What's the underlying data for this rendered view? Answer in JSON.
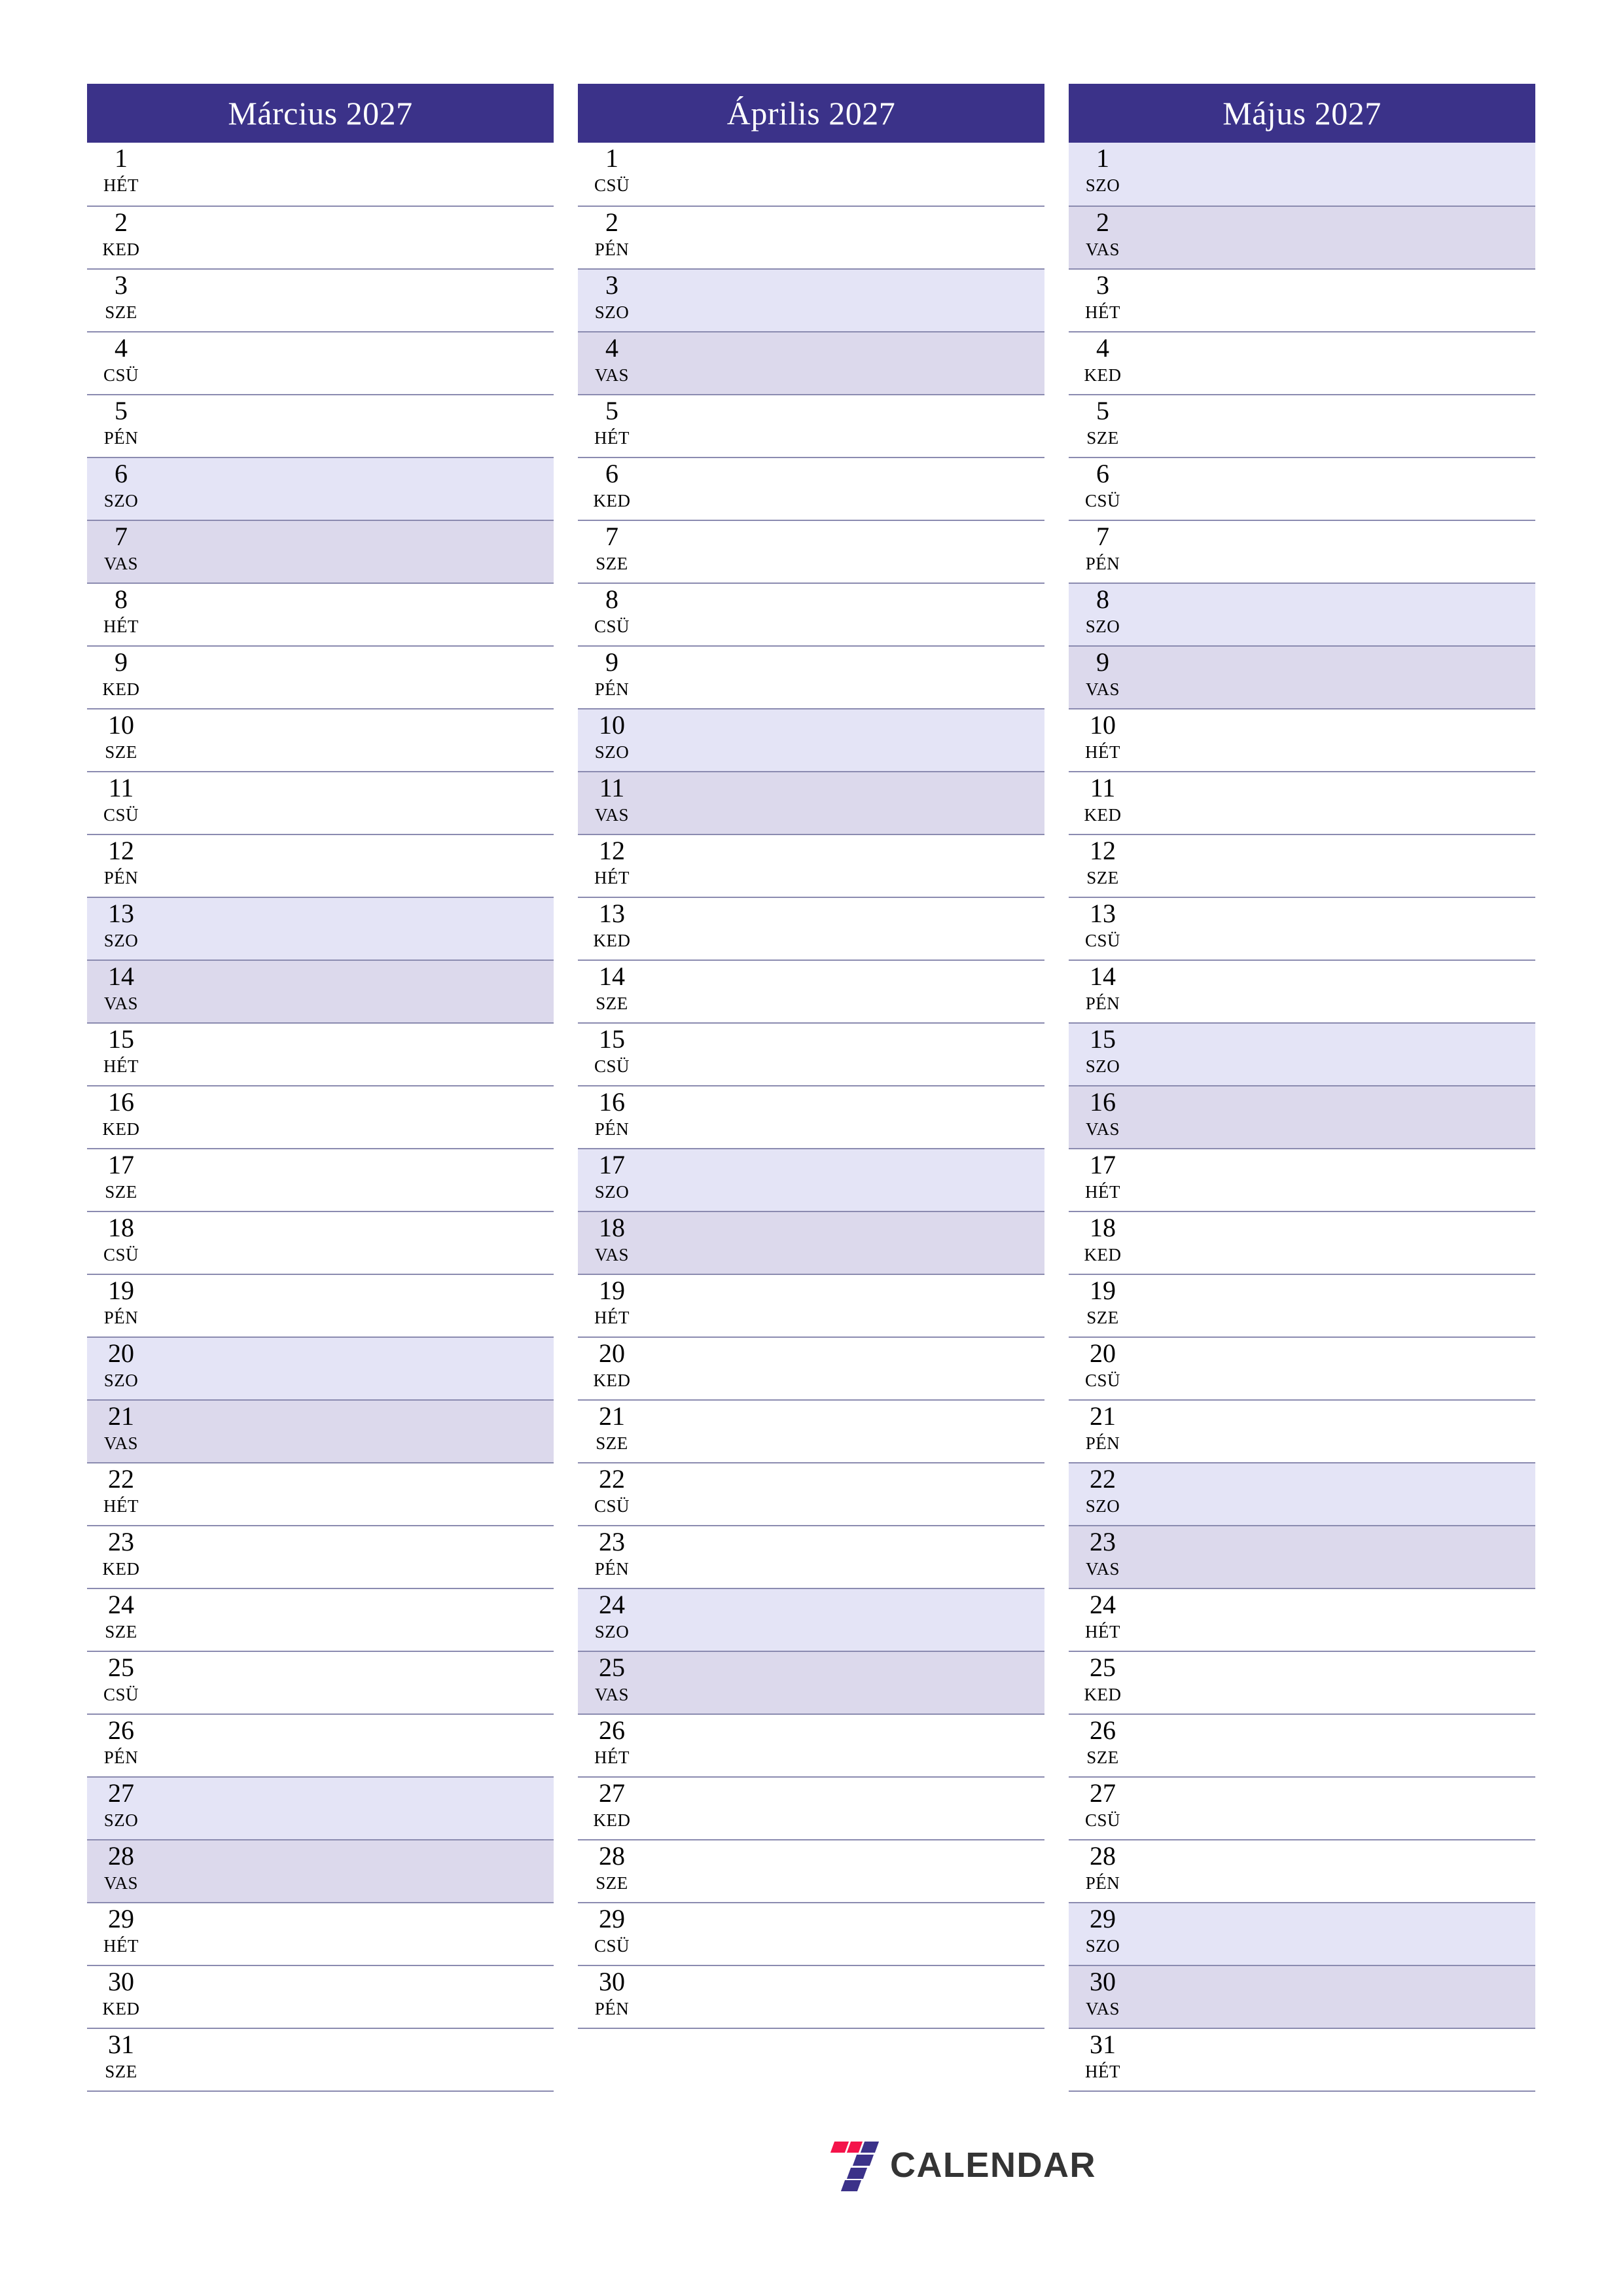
{
  "colors": {
    "header_bg": "#3b3289",
    "header_text": "#ffffff",
    "rule": "#8b8bb0",
    "saturday_bg": "#e4e4f6",
    "sunday_bg": "#dcd9ec",
    "page_bg": "#ffffff",
    "logo_red": "#f4134a",
    "logo_indigo": "#3b3289",
    "logo_text": "#343434"
  },
  "footer": {
    "logo_icon": "seven-blocks-icon",
    "brand": "CALENDAR"
  },
  "months": [
    {
      "title": "Március 2027",
      "days": [
        {
          "num": "1",
          "abbr": "HÉT",
          "type": "weekday"
        },
        {
          "num": "2",
          "abbr": "KED",
          "type": "weekday"
        },
        {
          "num": "3",
          "abbr": "SZE",
          "type": "weekday"
        },
        {
          "num": "4",
          "abbr": "CSÜ",
          "type": "weekday"
        },
        {
          "num": "5",
          "abbr": "PÉN",
          "type": "weekday"
        },
        {
          "num": "6",
          "abbr": "SZO",
          "type": "sat"
        },
        {
          "num": "7",
          "abbr": "VAS",
          "type": "sun"
        },
        {
          "num": "8",
          "abbr": "HÉT",
          "type": "weekday"
        },
        {
          "num": "9",
          "abbr": "KED",
          "type": "weekday"
        },
        {
          "num": "10",
          "abbr": "SZE",
          "type": "weekday"
        },
        {
          "num": "11",
          "abbr": "CSÜ",
          "type": "weekday"
        },
        {
          "num": "12",
          "abbr": "PÉN",
          "type": "weekday"
        },
        {
          "num": "13",
          "abbr": "SZO",
          "type": "sat"
        },
        {
          "num": "14",
          "abbr": "VAS",
          "type": "sun"
        },
        {
          "num": "15",
          "abbr": "HÉT",
          "type": "weekday"
        },
        {
          "num": "16",
          "abbr": "KED",
          "type": "weekday"
        },
        {
          "num": "17",
          "abbr": "SZE",
          "type": "weekday"
        },
        {
          "num": "18",
          "abbr": "CSÜ",
          "type": "weekday"
        },
        {
          "num": "19",
          "abbr": "PÉN",
          "type": "weekday"
        },
        {
          "num": "20",
          "abbr": "SZO",
          "type": "sat"
        },
        {
          "num": "21",
          "abbr": "VAS",
          "type": "sun"
        },
        {
          "num": "22",
          "abbr": "HÉT",
          "type": "weekday"
        },
        {
          "num": "23",
          "abbr": "KED",
          "type": "weekday"
        },
        {
          "num": "24",
          "abbr": "SZE",
          "type": "weekday"
        },
        {
          "num": "25",
          "abbr": "CSÜ",
          "type": "weekday"
        },
        {
          "num": "26",
          "abbr": "PÉN",
          "type": "weekday"
        },
        {
          "num": "27",
          "abbr": "SZO",
          "type": "sat"
        },
        {
          "num": "28",
          "abbr": "VAS",
          "type": "sun"
        },
        {
          "num": "29",
          "abbr": "HÉT",
          "type": "weekday"
        },
        {
          "num": "30",
          "abbr": "KED",
          "type": "weekday"
        },
        {
          "num": "31",
          "abbr": "SZE",
          "type": "weekday"
        }
      ]
    },
    {
      "title": "Április 2027",
      "days": [
        {
          "num": "1",
          "abbr": "CSÜ",
          "type": "weekday"
        },
        {
          "num": "2",
          "abbr": "PÉN",
          "type": "weekday"
        },
        {
          "num": "3",
          "abbr": "SZO",
          "type": "sat"
        },
        {
          "num": "4",
          "abbr": "VAS",
          "type": "sun"
        },
        {
          "num": "5",
          "abbr": "HÉT",
          "type": "weekday"
        },
        {
          "num": "6",
          "abbr": "KED",
          "type": "weekday"
        },
        {
          "num": "7",
          "abbr": "SZE",
          "type": "weekday"
        },
        {
          "num": "8",
          "abbr": "CSÜ",
          "type": "weekday"
        },
        {
          "num": "9",
          "abbr": "PÉN",
          "type": "weekday"
        },
        {
          "num": "10",
          "abbr": "SZO",
          "type": "sat"
        },
        {
          "num": "11",
          "abbr": "VAS",
          "type": "sun"
        },
        {
          "num": "12",
          "abbr": "HÉT",
          "type": "weekday"
        },
        {
          "num": "13",
          "abbr": "KED",
          "type": "weekday"
        },
        {
          "num": "14",
          "abbr": "SZE",
          "type": "weekday"
        },
        {
          "num": "15",
          "abbr": "CSÜ",
          "type": "weekday"
        },
        {
          "num": "16",
          "abbr": "PÉN",
          "type": "weekday"
        },
        {
          "num": "17",
          "abbr": "SZO",
          "type": "sat"
        },
        {
          "num": "18",
          "abbr": "VAS",
          "type": "sun"
        },
        {
          "num": "19",
          "abbr": "HÉT",
          "type": "weekday"
        },
        {
          "num": "20",
          "abbr": "KED",
          "type": "weekday"
        },
        {
          "num": "21",
          "abbr": "SZE",
          "type": "weekday"
        },
        {
          "num": "22",
          "abbr": "CSÜ",
          "type": "weekday"
        },
        {
          "num": "23",
          "abbr": "PÉN",
          "type": "weekday"
        },
        {
          "num": "24",
          "abbr": "SZO",
          "type": "sat"
        },
        {
          "num": "25",
          "abbr": "VAS",
          "type": "sun"
        },
        {
          "num": "26",
          "abbr": "HÉT",
          "type": "weekday"
        },
        {
          "num": "27",
          "abbr": "KED",
          "type": "weekday"
        },
        {
          "num": "28",
          "abbr": "SZE",
          "type": "weekday"
        },
        {
          "num": "29",
          "abbr": "CSÜ",
          "type": "weekday"
        },
        {
          "num": "30",
          "abbr": "PÉN",
          "type": "weekday"
        }
      ]
    },
    {
      "title": "Május 2027",
      "days": [
        {
          "num": "1",
          "abbr": "SZO",
          "type": "sat"
        },
        {
          "num": "2",
          "abbr": "VAS",
          "type": "sun"
        },
        {
          "num": "3",
          "abbr": "HÉT",
          "type": "weekday"
        },
        {
          "num": "4",
          "abbr": "KED",
          "type": "weekday"
        },
        {
          "num": "5",
          "abbr": "SZE",
          "type": "weekday"
        },
        {
          "num": "6",
          "abbr": "CSÜ",
          "type": "weekday"
        },
        {
          "num": "7",
          "abbr": "PÉN",
          "type": "weekday"
        },
        {
          "num": "8",
          "abbr": "SZO",
          "type": "sat"
        },
        {
          "num": "9",
          "abbr": "VAS",
          "type": "sun"
        },
        {
          "num": "10",
          "abbr": "HÉT",
          "type": "weekday"
        },
        {
          "num": "11",
          "abbr": "KED",
          "type": "weekday"
        },
        {
          "num": "12",
          "abbr": "SZE",
          "type": "weekday"
        },
        {
          "num": "13",
          "abbr": "CSÜ",
          "type": "weekday"
        },
        {
          "num": "14",
          "abbr": "PÉN",
          "type": "weekday"
        },
        {
          "num": "15",
          "abbr": "SZO",
          "type": "sat"
        },
        {
          "num": "16",
          "abbr": "VAS",
          "type": "sun"
        },
        {
          "num": "17",
          "abbr": "HÉT",
          "type": "weekday"
        },
        {
          "num": "18",
          "abbr": "KED",
          "type": "weekday"
        },
        {
          "num": "19",
          "abbr": "SZE",
          "type": "weekday"
        },
        {
          "num": "20",
          "abbr": "CSÜ",
          "type": "weekday"
        },
        {
          "num": "21",
          "abbr": "PÉN",
          "type": "weekday"
        },
        {
          "num": "22",
          "abbr": "SZO",
          "type": "sat"
        },
        {
          "num": "23",
          "abbr": "VAS",
          "type": "sun"
        },
        {
          "num": "24",
          "abbr": "HÉT",
          "type": "weekday"
        },
        {
          "num": "25",
          "abbr": "KED",
          "type": "weekday"
        },
        {
          "num": "26",
          "abbr": "SZE",
          "type": "weekday"
        },
        {
          "num": "27",
          "abbr": "CSÜ",
          "type": "weekday"
        },
        {
          "num": "28",
          "abbr": "PÉN",
          "type": "weekday"
        },
        {
          "num": "29",
          "abbr": "SZO",
          "type": "sat"
        },
        {
          "num": "30",
          "abbr": "VAS",
          "type": "sun"
        },
        {
          "num": "31",
          "abbr": "HÉT",
          "type": "weekday"
        }
      ]
    }
  ]
}
